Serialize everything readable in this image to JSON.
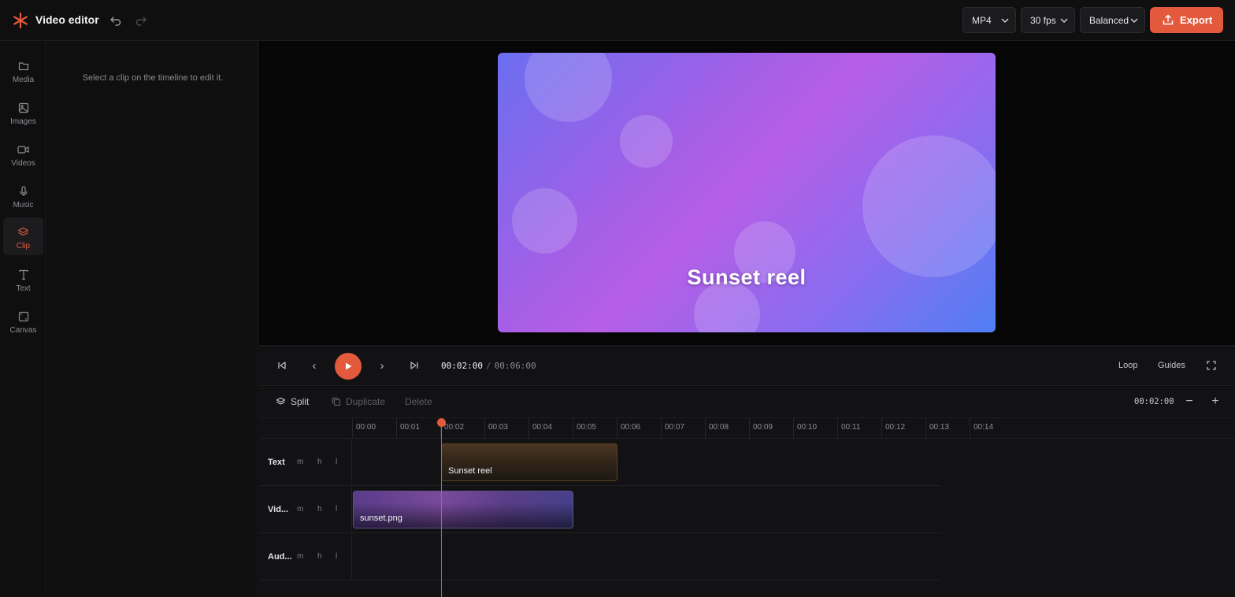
{
  "app": {
    "title": "Video editor"
  },
  "export_settings": {
    "format": "MP4",
    "fps": "30 fps",
    "quality": "Balanced",
    "export_label": "Export",
    "accent": "#e2593b"
  },
  "rail": {
    "items": [
      {
        "label": "Media",
        "icon": "folder-icon",
        "active": false
      },
      {
        "label": "Images",
        "icon": "image-icon",
        "active": false
      },
      {
        "label": "Videos",
        "icon": "video-camera-icon",
        "active": false
      },
      {
        "label": "Music",
        "icon": "microphone-icon",
        "active": false
      },
      {
        "label": "Clip",
        "icon": "layers-icon",
        "active": true
      },
      {
        "label": "Text",
        "icon": "text-icon",
        "active": false
      },
      {
        "label": "Canvas",
        "icon": "canvas-frame-icon",
        "active": false
      }
    ]
  },
  "panel": {
    "hint": "Select a clip on the timeline to edit it."
  },
  "preview": {
    "overlay_text": "Sunset reel"
  },
  "transport": {
    "current_time": "00:02:00",
    "separator": "/",
    "total_time": "00:06:00",
    "loop_label": "Loop",
    "guides_label": "Guides",
    "prev_label": "‹",
    "next_label": "›"
  },
  "timeline_toolbar": {
    "split_label": "Split",
    "duplicate_label": "Duplicate",
    "delete_label": "Delete",
    "zoom_time": "00:02:00",
    "zoom_out": "−",
    "zoom_in": "+"
  },
  "timeline": {
    "ticks": [
      "00:00",
      "00:01",
      "00:02",
      "00:03",
      "00:04",
      "00:05",
      "00:06",
      "00:07",
      "00:08",
      "00:09",
      "00:10",
      "00:11",
      "00:12",
      "00:13",
      "00:14"
    ],
    "tracks": [
      {
        "name": "Text",
        "m": "m",
        "h": "h",
        "l": "l",
        "clip_label": "Sunset reel"
      },
      {
        "name": "Vid...",
        "m": "m",
        "h": "h",
        "l": "l",
        "clip_label": "sunset.png"
      },
      {
        "name": "Aud...",
        "m": "m",
        "h": "h",
        "l": "l"
      }
    ]
  }
}
